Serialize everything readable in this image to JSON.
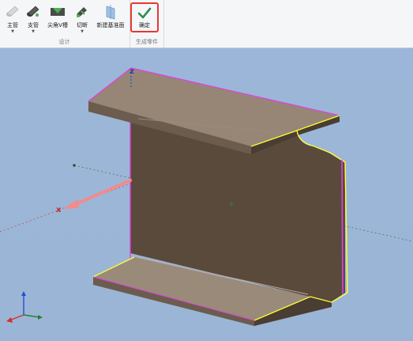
{
  "ribbon": {
    "design_group": {
      "label": "设计",
      "tools": [
        {
          "label": "主管",
          "icon": "main-pipe-icon"
        },
        {
          "label": "支管",
          "icon": "branch-pipe-icon"
        },
        {
          "label": "尖角V槽",
          "icon": "v-groove-icon"
        },
        {
          "label": "切断",
          "icon": "cut-icon"
        },
        {
          "label": "新建基准面",
          "icon": "datum-plane-icon"
        }
      ]
    },
    "generate_group": {
      "label": "生成零件",
      "confirm_label": "确定",
      "confirm_icon": "checkmark-icon",
      "confirm_color": "#2e8b57",
      "highlight_color": "#e53935"
    }
  },
  "viewport": {
    "background": "#9bb5d6",
    "axes": {
      "x": "x",
      "z": "z"
    },
    "model_color": "#6a5c4f",
    "edge_colors": [
      "#e040e0",
      "#ffff33"
    ]
  }
}
